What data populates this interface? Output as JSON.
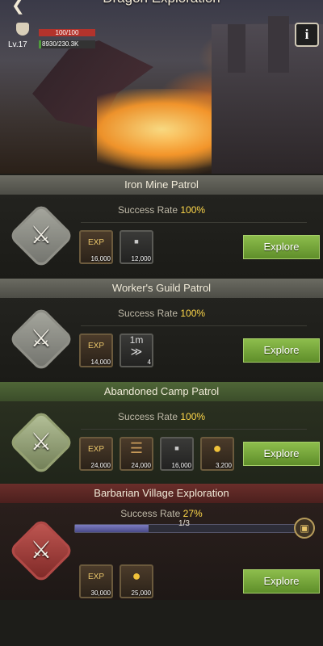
{
  "header": {
    "title": "Dragon Exploration",
    "hp": "100/100",
    "level": "Lv.17",
    "xp": "8930/230.3K",
    "xp_fraction": 0.039
  },
  "sections": [
    {
      "title": "Iron Mine Patrol",
      "rate_label": "Success Rate",
      "rate_value": "100%",
      "theme": "grey",
      "rewards": [
        {
          "icon": "exp-icon",
          "qty": "16,000"
        },
        {
          "icon": "iron-ingot-icon",
          "qty": "12,000"
        }
      ],
      "button": "Explore"
    },
    {
      "title": "Worker's Guild Patrol",
      "rate_label": "Success Rate",
      "rate_value": "100%",
      "theme": "grey",
      "rewards": [
        {
          "icon": "exp-icon",
          "qty": "14,000"
        },
        {
          "icon": "speedup-icon",
          "badge": "1m",
          "qty": "4"
        }
      ],
      "button": "Explore"
    },
    {
      "title": "Abandoned Camp Patrol",
      "rate_label": "Success Rate",
      "rate_value": "100%",
      "theme": "green",
      "rewards": [
        {
          "icon": "exp-icon",
          "qty": "24,000"
        },
        {
          "icon": "wood-icon",
          "qty": "24,000"
        },
        {
          "icon": "iron-ingot-icon",
          "qty": "16,000"
        },
        {
          "icon": "gold-coin-icon",
          "qty": "3,200"
        }
      ],
      "button": "Explore"
    },
    {
      "title": "Barbarian Village Exploration",
      "rate_label": "Success Rate",
      "rate_value": "27%",
      "theme": "red",
      "progress_text": "1/3",
      "progress_fraction": 0.333,
      "rewards": [
        {
          "icon": "exp-icon",
          "qty": "30,000"
        },
        {
          "icon": "gold-coin-icon",
          "qty": "25,000"
        }
      ],
      "button": "Explore"
    }
  ],
  "item_glyphs": {
    "exp": "EXP"
  }
}
